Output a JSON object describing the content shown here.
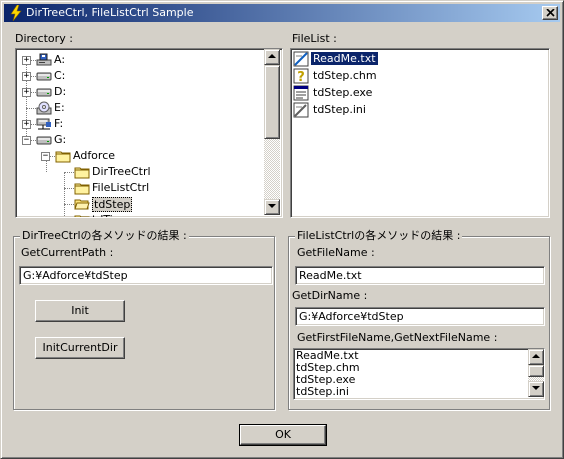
{
  "window": {
    "title": "DirTreeCtrl, FileListCtrl Sample",
    "close": "×"
  },
  "directory": {
    "label": "Directory :",
    "items": [
      {
        "label": "A:",
        "expander": "+",
        "icon": "floppy-drive-icon"
      },
      {
        "label": "C:",
        "expander": "+",
        "icon": "hard-drive-icon"
      },
      {
        "label": "D:",
        "expander": "+",
        "icon": "hard-drive-icon"
      },
      {
        "label": "E:",
        "expander": "",
        "icon": "cd-drive-icon"
      },
      {
        "label": "F:",
        "expander": "+",
        "icon": "network-drive-icon"
      },
      {
        "label": "G:",
        "expander": "-",
        "icon": "hard-drive-icon"
      },
      {
        "label": "Adforce",
        "expander": "-",
        "icon": "folder-icon"
      },
      {
        "label": "DirTreeCtrl",
        "expander": "",
        "icon": "folder-icon"
      },
      {
        "label": "FileListCtrl",
        "expander": "",
        "icon": "folder-icon"
      },
      {
        "label": "tdStep",
        "expander": "",
        "icon": "folder-open-icon"
      },
      {
        "label": "tdTimer",
        "expander": "",
        "icon": "folder-icon"
      }
    ]
  },
  "filelist": {
    "label": "FileList :",
    "items": [
      {
        "name": "ReadMe.txt",
        "icon": "text-file-icon",
        "selected": true
      },
      {
        "name": "tdStep.chm",
        "icon": "help-file-icon",
        "selected": false
      },
      {
        "name": "tdStep.exe",
        "icon": "exe-file-icon",
        "selected": false
      },
      {
        "name": "tdStep.ini",
        "icon": "ini-file-icon",
        "selected": false
      }
    ]
  },
  "dirgroup": {
    "title": "DirTreeCtrlの各メソッドの結果 :",
    "current_path_label": "GetCurrentPath :",
    "current_path_value": "G:¥Adforce¥tdStep",
    "init_button": "Init",
    "init_current_dir_button": "InitCurrentDir"
  },
  "filegroup": {
    "title": "FileListCtrlの各メソッドの結果 :",
    "filename_label": "GetFileName :",
    "filename_value": "ReadMe.txt",
    "dirname_label": "GetDirName :",
    "dirname_value": "G:¥Adforce¥tdStep",
    "firstnext_label": "GetFirstFileName,GetNextFileName :",
    "firstnext_items": [
      "ReadMe.txt",
      "tdStep.chm",
      "tdStep.exe",
      "tdStep.ini"
    ]
  },
  "ok_button": "OK",
  "colors": {
    "title_start": "#0a246a",
    "title_end": "#a6caf0",
    "face": "#d4d0c8",
    "selection": "#0a246a"
  }
}
